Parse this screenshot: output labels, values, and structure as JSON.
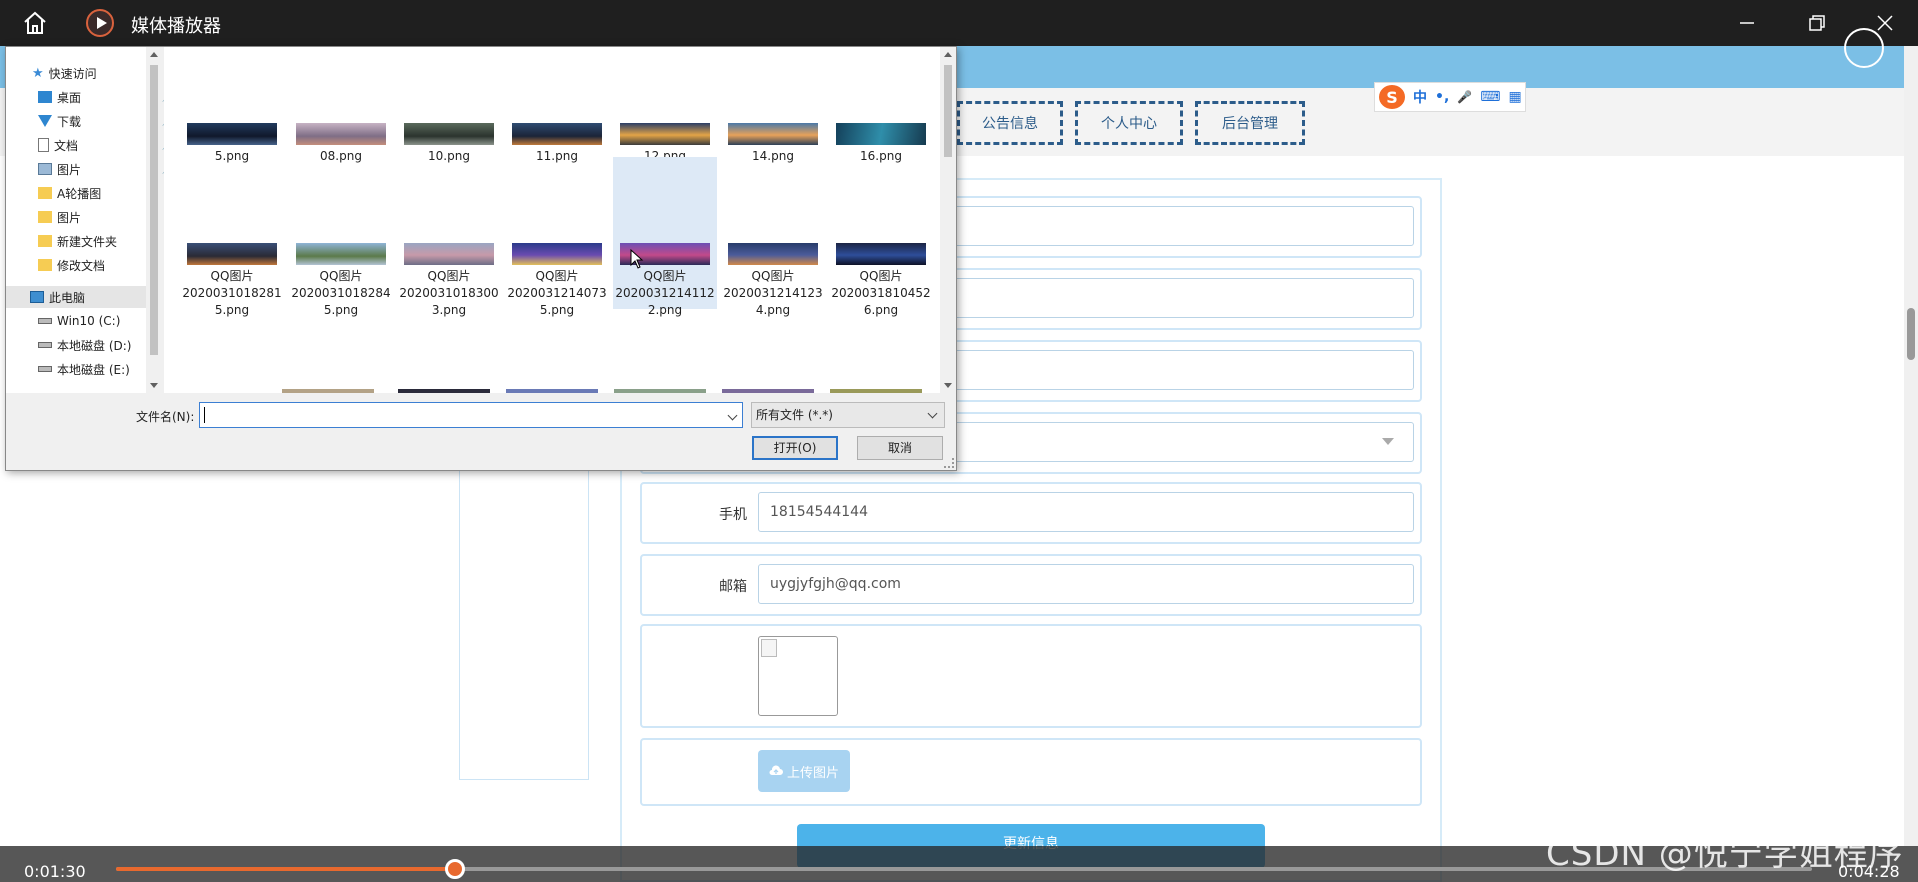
{
  "player": {
    "title": "媒体播放器",
    "time_current": "0:01:30",
    "time_total": "0:04:28",
    "progress": 0.2
  },
  "watermark": "CSDN @悦宁学姐程序",
  "nav": {
    "buttons": [
      "公告信息",
      "个人中心",
      "后台管理"
    ]
  },
  "ime": {
    "labels": [
      "中",
      "•,",
      "🎤",
      "⌨",
      "▦"
    ]
  },
  "form": {
    "phone_label": "手机",
    "phone_value": "18154544144",
    "email_label": "邮箱",
    "email_value": "uygjyfgjh@qq.com",
    "upload_label": "上传图片",
    "submit_label": "更新信息"
  },
  "dialog": {
    "nav_items": [
      {
        "label": "快速访问",
        "icon": "star-icon"
      },
      {
        "label": "桌面",
        "icon": "desktop-icon"
      },
      {
        "label": "下载",
        "icon": "download-icon"
      },
      {
        "label": "文档",
        "icon": "document-icon"
      },
      {
        "label": "图片",
        "icon": "picture-icon"
      },
      {
        "label": "A轮播图",
        "icon": "folder-icon"
      },
      {
        "label": "图片",
        "icon": "folder-icon"
      },
      {
        "label": "新建文件夹",
        "icon": "folder-icon"
      },
      {
        "label": "修改文档",
        "icon": "folder-icon"
      },
      {
        "label": "此电脑",
        "icon": "pc-icon"
      },
      {
        "label": "Win10 (C:)",
        "icon": "drive-icon"
      },
      {
        "label": "本地磁盘 (D:)",
        "icon": "drive-icon"
      },
      {
        "label": "本地磁盘 (E:)",
        "icon": "drive-icon"
      }
    ],
    "files_row1": [
      "5.png",
      "08.png",
      "10.png",
      "11.png",
      "12.png",
      "14.png",
      "16.png"
    ],
    "files_row2": [
      [
        "QQ图片",
        "2020031018281",
        "5.png"
      ],
      [
        "QQ图片",
        "2020031018284",
        "5.png"
      ],
      [
        "QQ图片",
        "2020031018300",
        "3.png"
      ],
      [
        "QQ图片",
        "2020031214073",
        "5.png"
      ],
      [
        "QQ图片",
        "2020031214112",
        "2.png"
      ],
      [
        "QQ图片",
        "2020031214123",
        "4.png"
      ],
      [
        "QQ图片",
        "2020031810452",
        "6.png"
      ]
    ],
    "filename_label": "文件名(N):",
    "filename_value": "",
    "filetype_value": "所有文件 (*.*)",
    "open_label": "打开(O)",
    "cancel_label": "取消"
  }
}
